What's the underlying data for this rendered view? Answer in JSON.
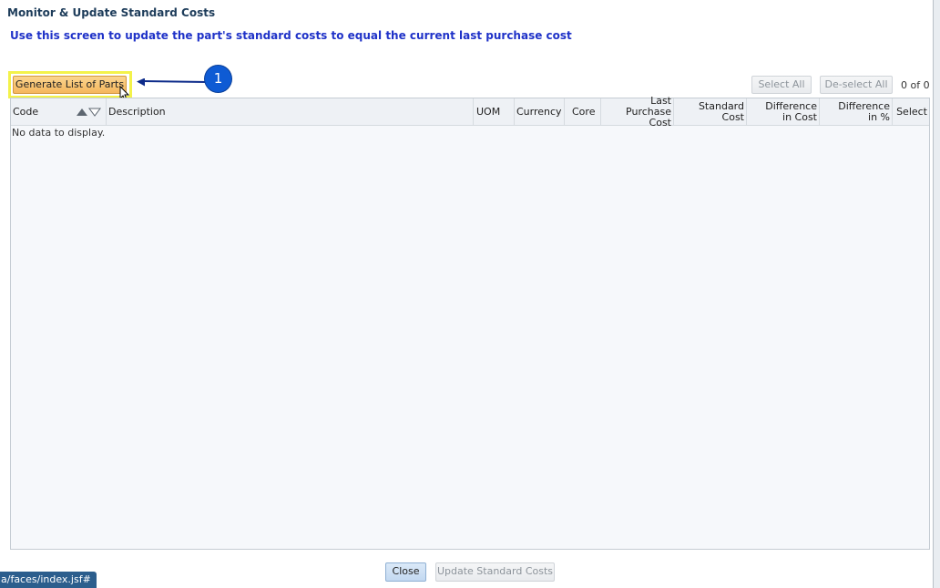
{
  "dialog": {
    "title": "Monitor & Update Standard Costs",
    "subtitle": "Use this screen to update the part's standard costs to equal the current last purchase cost"
  },
  "toolbar": {
    "generate_label": "Generate List of Parts",
    "select_all_label": "Select All",
    "deselect_all_label": "De-select All",
    "record_count": "0 of 0"
  },
  "callout": {
    "number": "1"
  },
  "table": {
    "columns": [
      {
        "key": "code",
        "label": "Code"
      },
      {
        "key": "description",
        "label": "Description"
      },
      {
        "key": "uom",
        "label": "UOM"
      },
      {
        "key": "currency",
        "label": "Currency"
      },
      {
        "key": "core",
        "label": "Core"
      },
      {
        "key": "last_purchase_cost",
        "label": "Last Purchase Cost"
      },
      {
        "key": "standard_cost",
        "label": "Standard Cost"
      },
      {
        "key": "difference_in_cost",
        "label": "Difference in Cost"
      },
      {
        "key": "difference_in_pct",
        "label": "Difference in %"
      },
      {
        "key": "select",
        "label": "Select"
      }
    ],
    "empty_message": "No data to display."
  },
  "footer": {
    "close_label": "Close",
    "update_label": "Update Standard Costs"
  },
  "status_bar": {
    "url_text": "a/faces/index.jsf#"
  },
  "colors": {
    "title": "#1d3c5a",
    "subtitle": "#1f32c8",
    "highlight": "#f3f24a",
    "callout": "#0e5bd4",
    "generate_button": "#f5b65c"
  },
  "icons": {
    "sort_ascending": "sort-ascending-icon",
    "sort_descending": "sort-descending-icon",
    "cursor": "mouse-pointer-icon"
  }
}
